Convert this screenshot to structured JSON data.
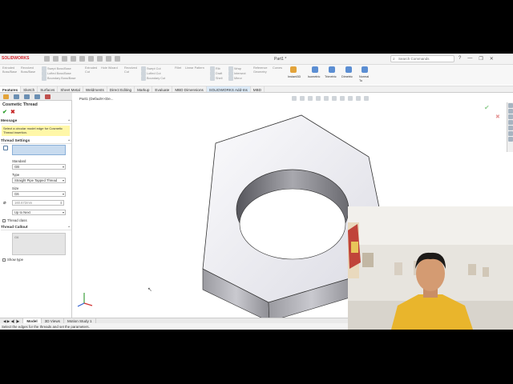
{
  "app": {
    "brand": "SOLIDWORKS",
    "doc_title": "Part1 *",
    "search_placeholder": "Search Commands",
    "window_controls": [
      "?",
      "—",
      "❐",
      "✕"
    ]
  },
  "ribbon": {
    "col1": [
      "Extruded",
      "Boss/Base"
    ],
    "col2": [
      "Revolved",
      "Boss/Base"
    ],
    "col3": [
      "Swept Boss/Base",
      "Lofted Boss/Base",
      "Boundary Boss/Base"
    ],
    "col4": [
      "Extruded",
      "Cut"
    ],
    "col5": [
      "Hole Wizard"
    ],
    "col6": [
      "Revolved",
      "Cut"
    ],
    "col7": [
      "Swept Cut",
      "Lofted Cut",
      "Boundary Cut"
    ],
    "col8": [
      "Fillet"
    ],
    "col9": [
      "Linear Pattern"
    ],
    "col10": [
      "Rib",
      "Draft",
      "Shell"
    ],
    "col11": [
      "Wrap",
      "Intersect",
      "Mirror"
    ],
    "col12": [
      "Reference",
      "Geometry"
    ],
    "col13": [
      "Curves"
    ],
    "col14": [
      "Instant3D"
    ],
    "views": [
      "Isometric",
      "Trimetric",
      "Dimetric",
      "Normal To"
    ]
  },
  "command_tabs": [
    "Features",
    "Sketch",
    "Surfaces",
    "Sheet Metal",
    "Weldments",
    "Direct Editing",
    "Markup",
    "Evaluate",
    "MBD Dimensions",
    "SOLIDWORKS Add-Ins",
    "MBD"
  ],
  "property_manager": {
    "title": "Cosmetic Thread",
    "message_header": "Message",
    "message": "Select a circular model edge for Cosmetic Thread insertion.",
    "thread_settings": "Thread Settings",
    "standard_label": "Standard",
    "standard_value": "GB",
    "type_label": "Type",
    "type_value": "Straight Pipe Tapped Thread",
    "size_label": "Size",
    "size_value": "G6",
    "diameter_value": "160.672mm",
    "end_condition": "Up to Next",
    "thread_class": "Thread class",
    "thread_callout": "Thread Callout",
    "callout_value": "G6",
    "show_type": "Show type"
  },
  "viewport": {
    "tree_path": "Part1 (Default<<De..."
  },
  "bottom_tabs": [
    "Model",
    "3D Views",
    "Motion Study 1"
  ],
  "status_text": "Select the edges for the threads and set the parameters.",
  "colors": {
    "brand": "#d31f26",
    "accent": "#dceaf7",
    "message_bg": "#fff7a8",
    "ok": "#2a9d2a",
    "cancel": "#c62828"
  }
}
